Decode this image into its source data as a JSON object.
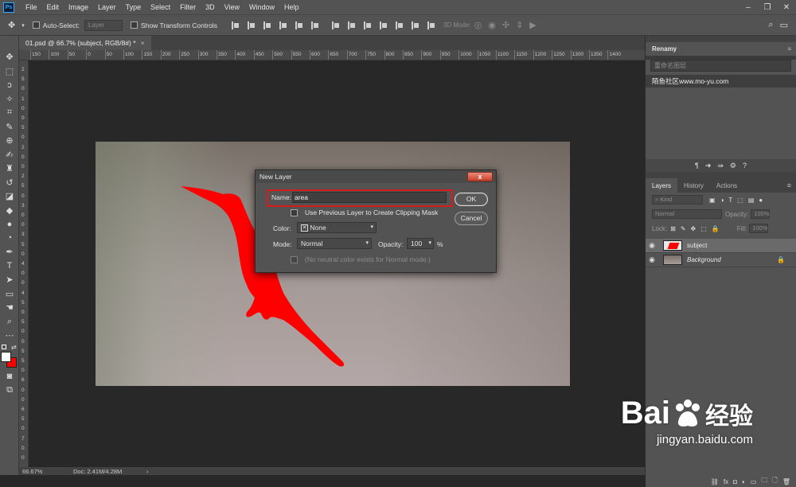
{
  "app": {
    "logo_text": "Ps"
  },
  "menu": [
    "File",
    "Edit",
    "Image",
    "Layer",
    "Type",
    "Select",
    "Filter",
    "3D",
    "View",
    "Window",
    "Help"
  ],
  "window_controls": {
    "minimize": "–",
    "restore": "❐",
    "close": "✕"
  },
  "options_bar": {
    "auto_select_label": "Auto-Select:",
    "auto_select_value": "Layer",
    "transform_label": "Show Transform Controls",
    "mode_3d_label": "3D Mode:"
  },
  "document_tab": {
    "title": "01.psd @ 66.7% (subject, RGB/8#) *",
    "close": "×"
  },
  "ruler_h_ticks": [
    "150",
    "100",
    "50",
    "0",
    "50",
    "100",
    "150",
    "200",
    "250",
    "300",
    "350",
    "400",
    "450",
    "500",
    "550",
    "600",
    "650",
    "700",
    "750",
    "800",
    "850",
    "900",
    "950",
    "1000",
    "1050",
    "1100",
    "1150",
    "1200",
    "1250",
    "1300",
    "1350",
    "1400"
  ],
  "ruler_v_ticks": [
    "2",
    "5",
    "0",
    "1",
    "0",
    "0",
    "5",
    "0",
    "2",
    "0",
    "0",
    "2",
    "5",
    "0",
    "3",
    "0",
    "0",
    "3",
    "5",
    "0",
    "4",
    "0",
    "0",
    "4",
    "5",
    "0",
    "5",
    "0",
    "0",
    "5",
    "5",
    "0",
    "6",
    "0",
    "0",
    "6",
    "5",
    "0",
    "7",
    "0",
    "0"
  ],
  "status": {
    "zoom": "66.67%",
    "doc": "Doc: 2.41M/4.28M",
    "arrow": "›"
  },
  "renamy_panel": {
    "title": "Renamy",
    "search_placeholder": "重命名图层",
    "site": "陌鱼社区www.mo-yu.com"
  },
  "layers_panel": {
    "tabs": [
      "Layers",
      "History",
      "Actions"
    ],
    "filter_label": "Kind",
    "blend_mode": "Normal",
    "opacity_label": "Opacity:",
    "opacity_value": "100%",
    "lock_label": "Lock:",
    "fill_label": "Fill:",
    "fill_value": "100%",
    "layers": [
      {
        "name": "subject",
        "selected": true
      },
      {
        "name": "Background",
        "selected": false,
        "locked": true
      }
    ],
    "footer_icons": [
      "⛓",
      "fx",
      "◘",
      "◐",
      "▭",
      "🗀",
      "🗋",
      "🗑"
    ]
  },
  "dialog": {
    "title": "New Layer",
    "close_label": "x",
    "name_label": "Name:",
    "name_value": "area",
    "clipping_label": "Use Previous Layer to Create Clipping Mask",
    "color_label": "Color:",
    "color_value": "None",
    "mode_label": "Mode:",
    "mode_value": "Normal",
    "opacity_label": "Opacity:",
    "opacity_value": "100",
    "opacity_unit": "%",
    "neutral_label": "(No neutral color exists for Normal mode.)",
    "ok_label": "OK",
    "cancel_label": "Cancel"
  },
  "watermark": {
    "brand": "Bai",
    "brand_suffix": "经验",
    "url": "jingyan.baidu.com"
  },
  "colors": {
    "accent_red": "#d81a1a",
    "ps_blue": "#31a8ff",
    "subject_red": "#ff0000"
  }
}
